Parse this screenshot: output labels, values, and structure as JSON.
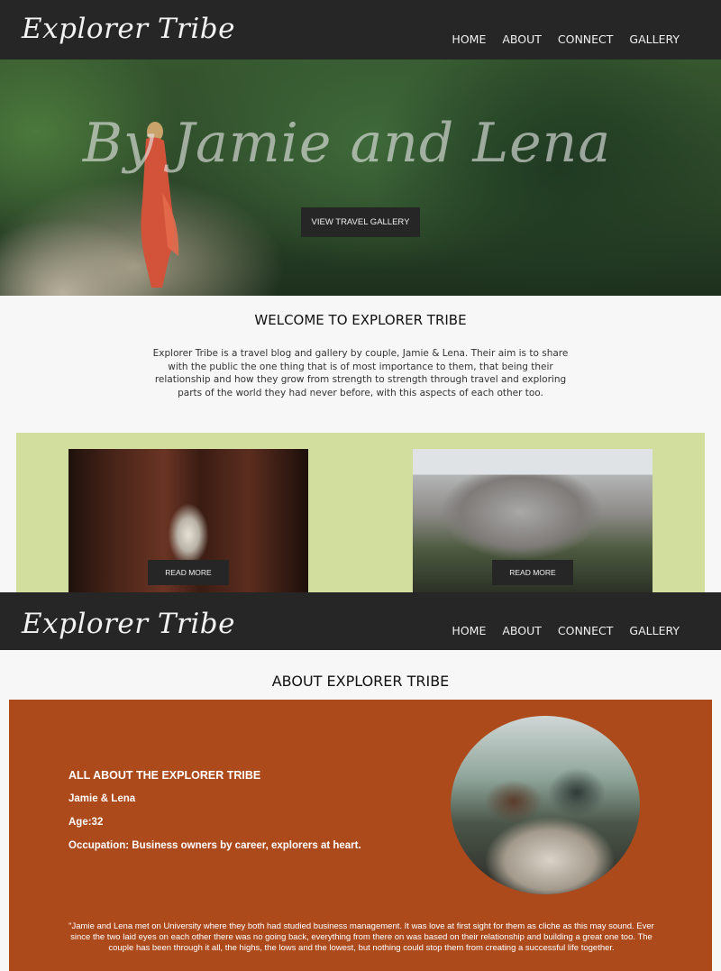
{
  "site": {
    "logo": "Explorer Tribe"
  },
  "nav": {
    "home": "HOME",
    "about": "ABOUT",
    "connect": "CONNECT",
    "gallery": "GALLERY"
  },
  "hero": {
    "title": "By Jamie and Lena",
    "button": "VIEW TRAVEL GALLERY"
  },
  "welcome": {
    "title": "WELCOME TO EXPLORER TRIBE",
    "text": "Explorer Tribe is a travel blog and gallery by couple, Jamie & Lena. Their aim is to share with the public the one thing that is of most importance to them, that being their relationship and how they grow from strength to strength through travel and exploring parts of the world they had never before, with this aspects of each other too."
  },
  "cards": [
    {
      "button": "READ MORE"
    },
    {
      "button": "READ MORE"
    }
  ],
  "about": {
    "title": "ABOUT EXPLORER TRIBE",
    "heading": "ALL ABOUT THE EXPLORER TRIBE",
    "names": "Jamie & Lena",
    "age": "Age:32",
    "occupation": "Occupation: Business owners by career, explorers at heart.",
    "story": "\"Jamie and Lena met on University where they both had studied business management. It was love at first sight for them as cliche as this may sound. Ever since the two laid eyes on each other there was no going back, everything from there on was based on their relationship and building a great one too. The couple has been through it all, the highs, the lows and the lowest, but nothing could stop them from creating a successful life together."
  },
  "colors": {
    "nav_bg": "#262626",
    "green_strip": "#d2de9e",
    "about_bg": "#ad4a1c"
  }
}
